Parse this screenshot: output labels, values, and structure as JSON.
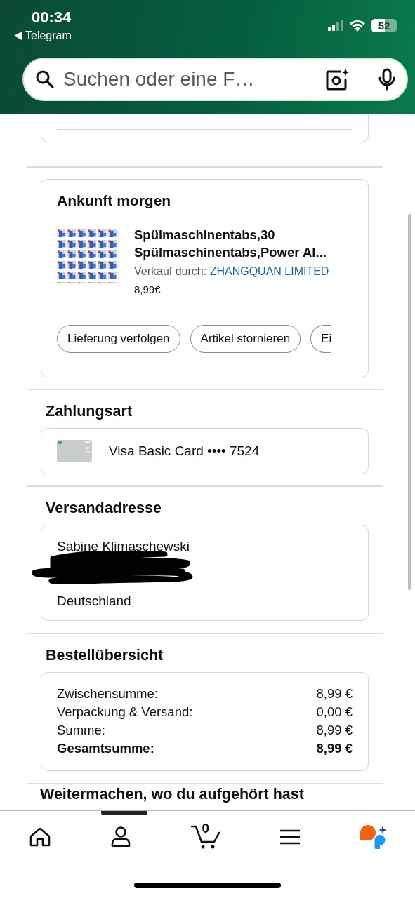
{
  "status_bar": {
    "time": "00:34",
    "back_app": "Telegram",
    "battery": "52"
  },
  "header": {
    "search": {
      "placeholder": "Suchen oder eine F…"
    }
  },
  "delivery": {
    "title": "Ankunft morgen",
    "item": {
      "title": "Spülmaschinentabs,30 Spülmaschinentabs,Power Al...",
      "seller_label": "Verkauf durch:",
      "seller": "ZHANGQUAN LIMITED",
      "price": "8,99€"
    },
    "actions": [
      "Lieferung verfolgen",
      "Artikel stornieren",
      "Ei"
    ]
  },
  "payment": {
    "title": "Zahlungsart",
    "method": "Visa Basic Card •••• 7524"
  },
  "address": {
    "title": "Versandadresse",
    "lines": [
      "Sabine Klimaschewski",
      "Deutschland"
    ]
  },
  "summary": {
    "title": "Bestellübersicht",
    "rows": [
      {
        "label": "Zwischensumme:",
        "value": "8,99 €",
        "kind": "line"
      },
      {
        "label": "Verpackung & Versand:",
        "value": "0,00 €",
        "kind": "line"
      },
      {
        "label": "Summe:",
        "value": "8,99 €",
        "kind": "line"
      },
      {
        "label": "Gesamtsumme:",
        "value": "8,99 €",
        "kind": "total"
      }
    ]
  },
  "next_section": {
    "title": "Weitermachen, wo du aufgehört hast"
  },
  "tab_bar": {
    "cart_count": "0"
  }
}
